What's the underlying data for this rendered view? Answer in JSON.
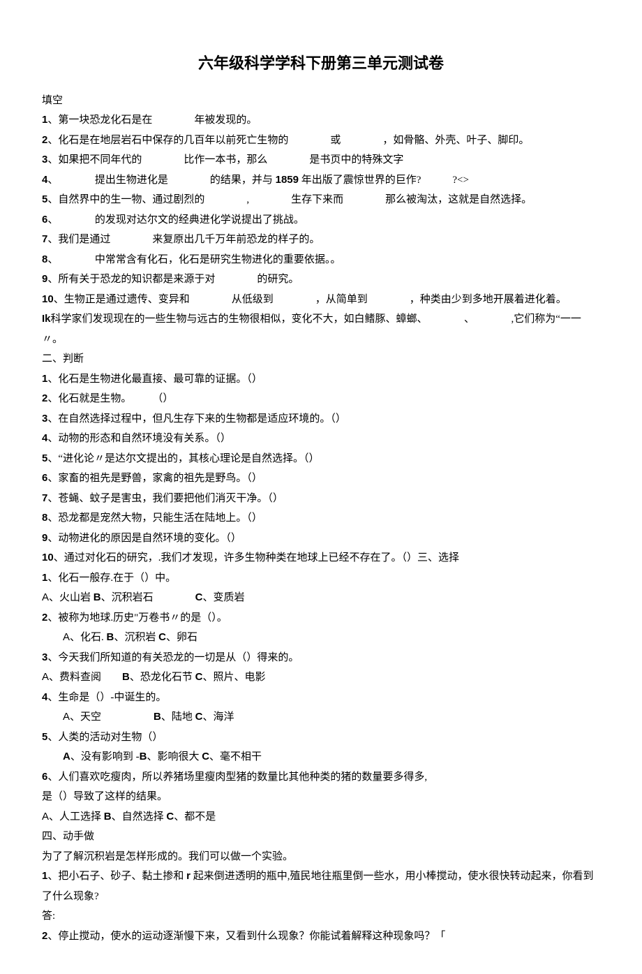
{
  "title": "六年级科学学科下册第三单元测试卷",
  "section1_label": "填空",
  "fill_blank": {
    "q1": {
      "n": "1",
      "text": "、第一块恐龙化石是在　　　　年被发现的。"
    },
    "q2": {
      "n": "2",
      "text": "、化石是在地层岩石中保存的几百年以前死亡生物的　　　　或　　　　，如骨骼、外壳、叶子、脚印。"
    },
    "q3": {
      "n": "3",
      "text": "、如果把不同年代的　　　　比作一本书，那么　　　　是书页中的特殊文字"
    },
    "q4": {
      "n": "4",
      "text_a": "、　　　　提出生物进化是　　　　的结果，并与 ",
      "year": "1859",
      "text_b": " 年出版了震惊世界的巨作?　　　?<>"
    },
    "q5": {
      "n": "5",
      "text": "、自然界中的生一物、通过剧烈的　　　　,　　　　生存下来而　　　　那么被淘汰，这就是自然选择。"
    },
    "q6": {
      "n": "6",
      "text": "、　　　　的发现对达尔文的经典进化学说提出了挑战。"
    },
    "q7": {
      "n": "7",
      "text": "、我们是通过　　　　来复原出几千万年前恐龙的样子的。"
    },
    "q8": {
      "n": "8",
      "text": "、　　　　中常常含有化石，化石是研究生物进化的重要依据。。"
    },
    "q9": {
      "n": "9",
      "text": "、所有关于恐龙的知识都是来源于对　　　　的研究。"
    },
    "q10": {
      "n": "10",
      "text": "、生物正是通过遗传、变异和　　　　从低级到　　　　，从简单到　　　　，种类由少到多地开展着进化着。"
    },
    "q11": {
      "n": "Ik",
      "text": "科学家们发现现在的一些生物与远古的生物很相似，变化不大，如白鳍豚、蟑螂、　　　　、　　　　,它们称为“一一〃。"
    }
  },
  "section2_label": "二、判断",
  "judge": {
    "q1": {
      "n": "1",
      "text": "、化石是生物进化最直接、最可靠的证据。（）"
    },
    "q2": {
      "n": "2",
      "text": "、化石就是生物。　　　（）"
    },
    "q3": {
      "n": "3",
      "text": "、在自然选择过程中，但凡生存下来的生物都是适应环境的。（）"
    },
    "q4": {
      "n": "4",
      "text": "、动物的形态和自然环境没有关系。（）"
    },
    "q5": {
      "n": "5",
      "text": "、“进化论〃是达尔文提出的，其核心理论是自然选择。（）"
    },
    "q6": {
      "n": "6",
      "text": "、家畜的祖先是野兽，家禽的祖先是野鸟。（）"
    },
    "q7": {
      "n": "7",
      "text": "、苍蝇、蚊子是害虫，我们要把他们消灭干净。（）"
    },
    "q8": {
      "n": "8",
      "text": "、恐龙都是宠然大物，只能生活在陆地上。（）"
    },
    "q9": {
      "n": "9",
      "text": "、动物进化的原因是自然环境的变化。（）"
    },
    "q10": {
      "n": "10",
      "text": "、通过对化石的研究，.我们才发现，许多生物种类在地球上已经不存在了。（）三、选择"
    }
  },
  "choice": {
    "q1": {
      "n": "1",
      "text": "、化石一般存.在于（）中。"
    },
    "q1_opts": {
      "a_label": "A",
      "a_text": "、火山岩 ",
      "b_label": "B",
      "b_text": "、沉积岩石　　　　",
      "c_label": "C",
      "c_text": "、变质岩"
    },
    "q2": {
      "n": "2",
      "text": "、被称为地球.历史\"万卷书〃的是（）。"
    },
    "q2_opts": {
      "a_label": "A",
      "a_text": "、化石. ",
      "b_label": "B",
      "b_text": "、沉积岩 ",
      "c_label": "C",
      "c_text": "、卵石"
    },
    "q3": {
      "n": "3",
      "text": "、今天我们所知道的有关恐龙的一切是从（）得来的。"
    },
    "q3_opts": {
      "a_label": "A",
      "a_text": "、费料查阅　　",
      "b_label": "B",
      "b_text": "、恐龙化石节 ",
      "c_label": "C",
      "c_text": "、照片、电影"
    },
    "q4": {
      "n": "4",
      "text": "、生命是（）-中诞生的。"
    },
    "q4_opts": {
      "a_label": "A",
      "a_text": "、天空　　　　　",
      "b_label": "B",
      "b_text": "、陆地 ",
      "c_label": "C",
      "c_text": "、海洋"
    },
    "q5": {
      "n": "5",
      "text": "、人类的活动对生物（）"
    },
    "q5_opts": {
      "a_label": "A",
      "a_text": "、没有影响到 -",
      "b_label": "B",
      "b_text": "、影响很大 ",
      "c_label": "C",
      "c_text": "、毫不相干"
    },
    "q6": {
      "n": "6",
      "text": "、人们喜欢吃瘦肉，所以养猪场里瘦肉型猪的数量比其他种类的猪的数量要多得多,"
    },
    "q6_line2": "是（）导致了这样的结果。",
    "q6_opts": {
      "a_label": "A",
      "a_text": "、人工选择 ",
      "b_label": "B",
      "b_text": "、自然选择 ",
      "c_label": "C",
      "c_text": "、都不是"
    }
  },
  "section4_label": "四、动手做",
  "hands_on": {
    "intro": "为了了解沉积岩是怎样形成的。我们可以做一个实验。",
    "q1": {
      "n": "1",
      "text_a": "、把小石子、砂子、黏土掺和 ",
      "r": "r",
      "text_b": " 起来倒进透明的瓶中,殖民地往瓶里倒一些水，用小棒搅动，使水很快转动起来，你看到了什么现象?"
    },
    "answer_label": "答:",
    "q2": {
      "n": "2",
      "text": "、停止搅动，使水的运动逐渐慢下来，又看到什么现象？你能试着解释这种现象吗？「"
    }
  }
}
